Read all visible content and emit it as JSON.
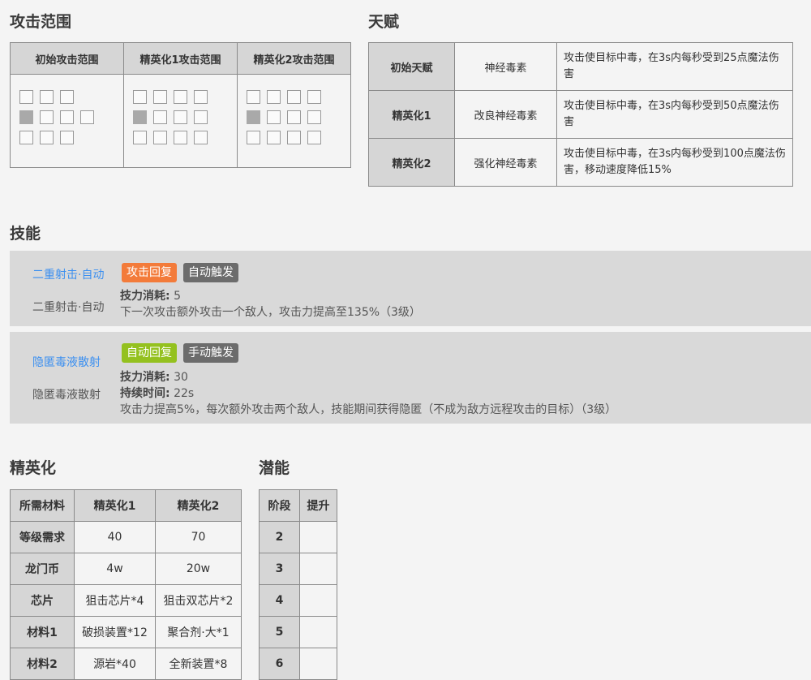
{
  "range": {
    "title": "攻击范围",
    "headers": [
      "初始攻击范围",
      "精英化1攻击范围",
      "精英化2攻击范围"
    ]
  },
  "talent": {
    "title": "天赋",
    "rows": [
      {
        "level": "初始天赋",
        "name": "神经毒素",
        "desc": "攻击使目标中毒，在3s内每秒受到25点魔法伤害"
      },
      {
        "level": "精英化1",
        "name": "改良神经毒素",
        "desc": "攻击使目标中毒，在3s内每秒受到50点魔法伤害"
      },
      {
        "level": "精英化2",
        "name": "强化神经毒素",
        "desc": "攻击使目标中毒，在3s内每秒受到100点魔法伤害，移动速度降低15%"
      }
    ]
  },
  "skills": {
    "title": "技能",
    "items": [
      {
        "name_link": "二重射击·自动",
        "name": "二重射击·自动",
        "badge_recovery": "攻击回复",
        "badge_trigger": "自动触发",
        "cost_label": "技力消耗:",
        "cost_value": "5",
        "desc": "下一次攻击额外攻击一个敌人，攻击力提高至135%（3级）"
      },
      {
        "name_link": "隐匿毒液散射",
        "name": "隐匿毒液散射",
        "badge_recovery": "自动回复",
        "badge_trigger": "手动触发",
        "cost_label": "技力消耗:",
        "cost_value": "30",
        "duration_label": "持续时间:",
        "duration_value": "22s",
        "desc": "攻击力提高5%，每次额外攻击两个敌人，技能期间获得隐匿（不成为敌方远程攻击的目标）（3级）"
      }
    ]
  },
  "elite": {
    "title": "精英化",
    "headers": [
      "所需材料",
      "精英化1",
      "精英化2"
    ],
    "rows": [
      {
        "label": "等级需求",
        "e1": "40",
        "e2": "70"
      },
      {
        "label": "龙门币",
        "e1": "4w",
        "e2": "20w"
      },
      {
        "label": "芯片",
        "e1": "狙击芯片*4",
        "e2": "狙击双芯片*2"
      },
      {
        "label": "材料1",
        "e1": "破损装置*12",
        "e2": "聚合剂·大*1"
      },
      {
        "label": "材料2",
        "e1": "源岩*40",
        "e2": "全新装置*8"
      }
    ]
  },
  "potential": {
    "title": "潜能",
    "headers": [
      "阶段",
      "提升"
    ],
    "rows": [
      {
        "stage": "2",
        "boost": ""
      },
      {
        "stage": "3",
        "boost": ""
      },
      {
        "stage": "4",
        "boost": ""
      },
      {
        "stage": "5",
        "boost": ""
      },
      {
        "stage": "6",
        "boost": ""
      }
    ]
  }
}
